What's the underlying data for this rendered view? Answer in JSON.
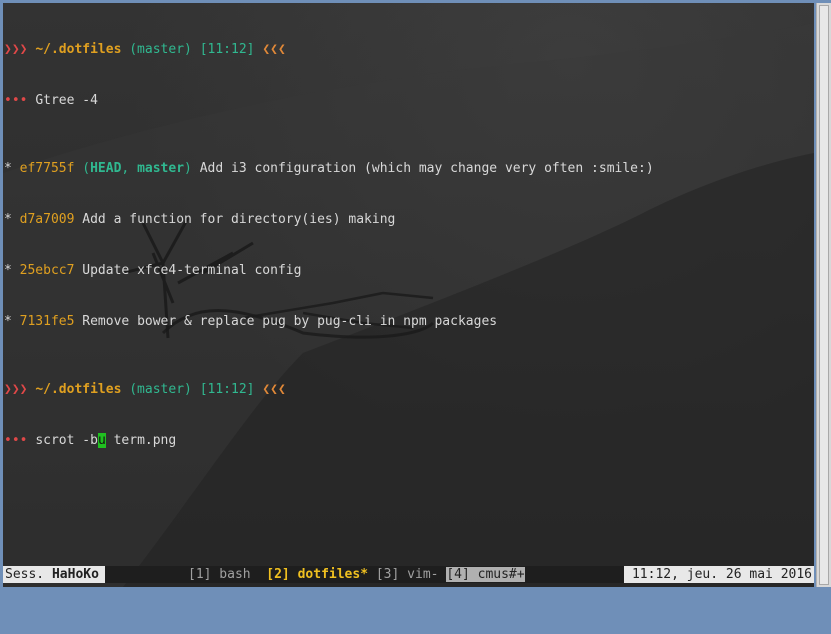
{
  "prompt1": {
    "arrows": "❯❯❯",
    "path": "~/.dotfiles",
    "branch": "(master)",
    "time": "[11:12]",
    "marks": "❮❮❮",
    "dots": "•••",
    "command": "Gtree -4"
  },
  "log": [
    {
      "star": "*",
      "hash": "ef7755f",
      "refs_open": "(",
      "head": "HEAD",
      "sep": ", ",
      "branch": "master",
      "refs_close": ")",
      "message": " Add i3 configuration (which may change very often :smile:)"
    },
    {
      "star": "*",
      "hash": "d7a7009",
      "message": " Add a function for directory(ies) making"
    },
    {
      "star": "*",
      "hash": "25ebcc7",
      "message": " Update xfce4-terminal config"
    },
    {
      "star": "*",
      "hash": "7131fe5",
      "message": " Remove bower & replace pug by pug-cli in npm packages"
    }
  ],
  "prompt2": {
    "arrows": "❯❯❯",
    "path": "~/.dotfiles",
    "branch": "(master)",
    "time": "[11:12]",
    "marks": "❮❮❮",
    "dots": "•••",
    "command_before": "scrot -b",
    "cursor_char": "u",
    "command_after": " term.png"
  },
  "statusbar": {
    "session_label": "Sess. ",
    "session_name": "HaHoKo",
    "window1": "[1] bash",
    "window2": "[2] dotfiles*",
    "window3": "[3] vim-",
    "window4": "[4] cmus#+",
    "clock": "11:12, jeu. 26 mai 2016"
  }
}
